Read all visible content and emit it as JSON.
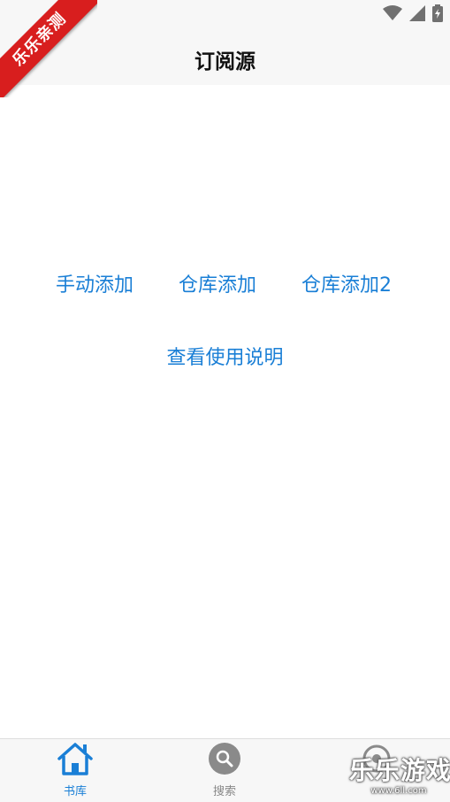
{
  "app_bar": {
    "title": "订阅源"
  },
  "actions": {
    "manual_add": "手动添加",
    "repo_add": "仓库添加",
    "repo_add_2": "仓库添加2",
    "view_guide": "查看使用说明"
  },
  "bottom_nav": {
    "items": [
      {
        "label": "书库",
        "icon": "home-icon",
        "active": true
      },
      {
        "label": "搜索",
        "icon": "search-icon",
        "active": false
      },
      {
        "label": "",
        "icon": "settings-icon",
        "active": false
      }
    ]
  },
  "overlays": {
    "corner_ribbon": "乐乐亲测",
    "watermark_text": "乐乐游戏",
    "watermark_url": "www.6ll.com"
  },
  "colors": {
    "accent": "#1a7fd6",
    "inactive": "#888888",
    "bar_background": "#f7f7f7",
    "ribbon": "#d81e1e"
  }
}
